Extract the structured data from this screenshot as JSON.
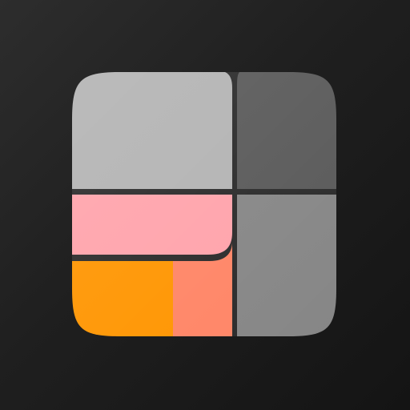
{
  "app_icon": {
    "tiles": [
      {
        "id": "top-left",
        "color": "#b3b3b3"
      },
      {
        "id": "top-right",
        "color": "#595959"
      },
      {
        "id": "middle-left",
        "color": "#ffa3ab"
      },
      {
        "id": "bottom-right",
        "color": "#868686"
      },
      {
        "id": "bottom-left-a",
        "color": "#ff9500"
      },
      {
        "id": "bottom-left-b",
        "color": "#ff8566"
      }
    ],
    "divider_color": "#2a2a2a",
    "background_gradient": [
      "#2d2d2d",
      "#141414"
    ]
  }
}
